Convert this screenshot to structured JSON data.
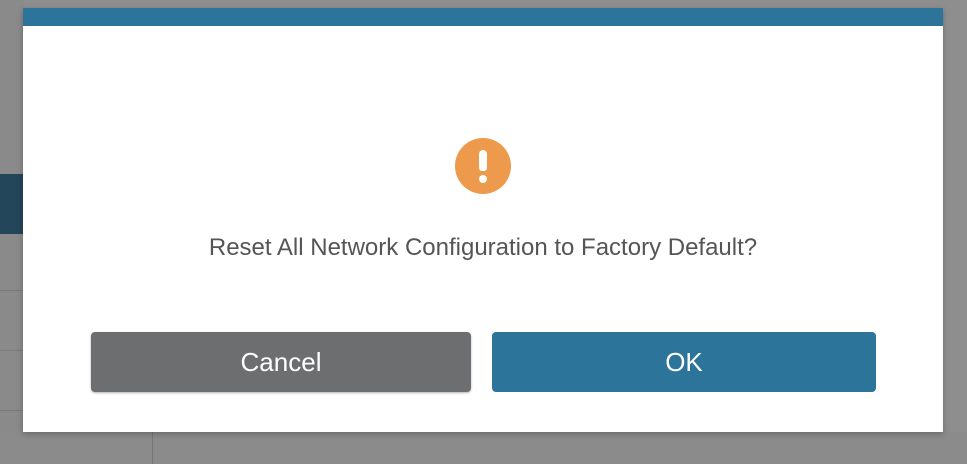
{
  "dialog": {
    "icon": "exclamation-circle-icon",
    "message": "Reset All Network Configuration to Factory Default?",
    "buttons": {
      "cancel_label": "Cancel",
      "ok_label": "OK"
    }
  },
  "colors": {
    "header_bar": "#2c7499",
    "alert_icon": "#ee9a4d",
    "cancel_button": "#6d6e70",
    "ok_button": "#2c7499",
    "overlay": "#8e8e8e"
  }
}
